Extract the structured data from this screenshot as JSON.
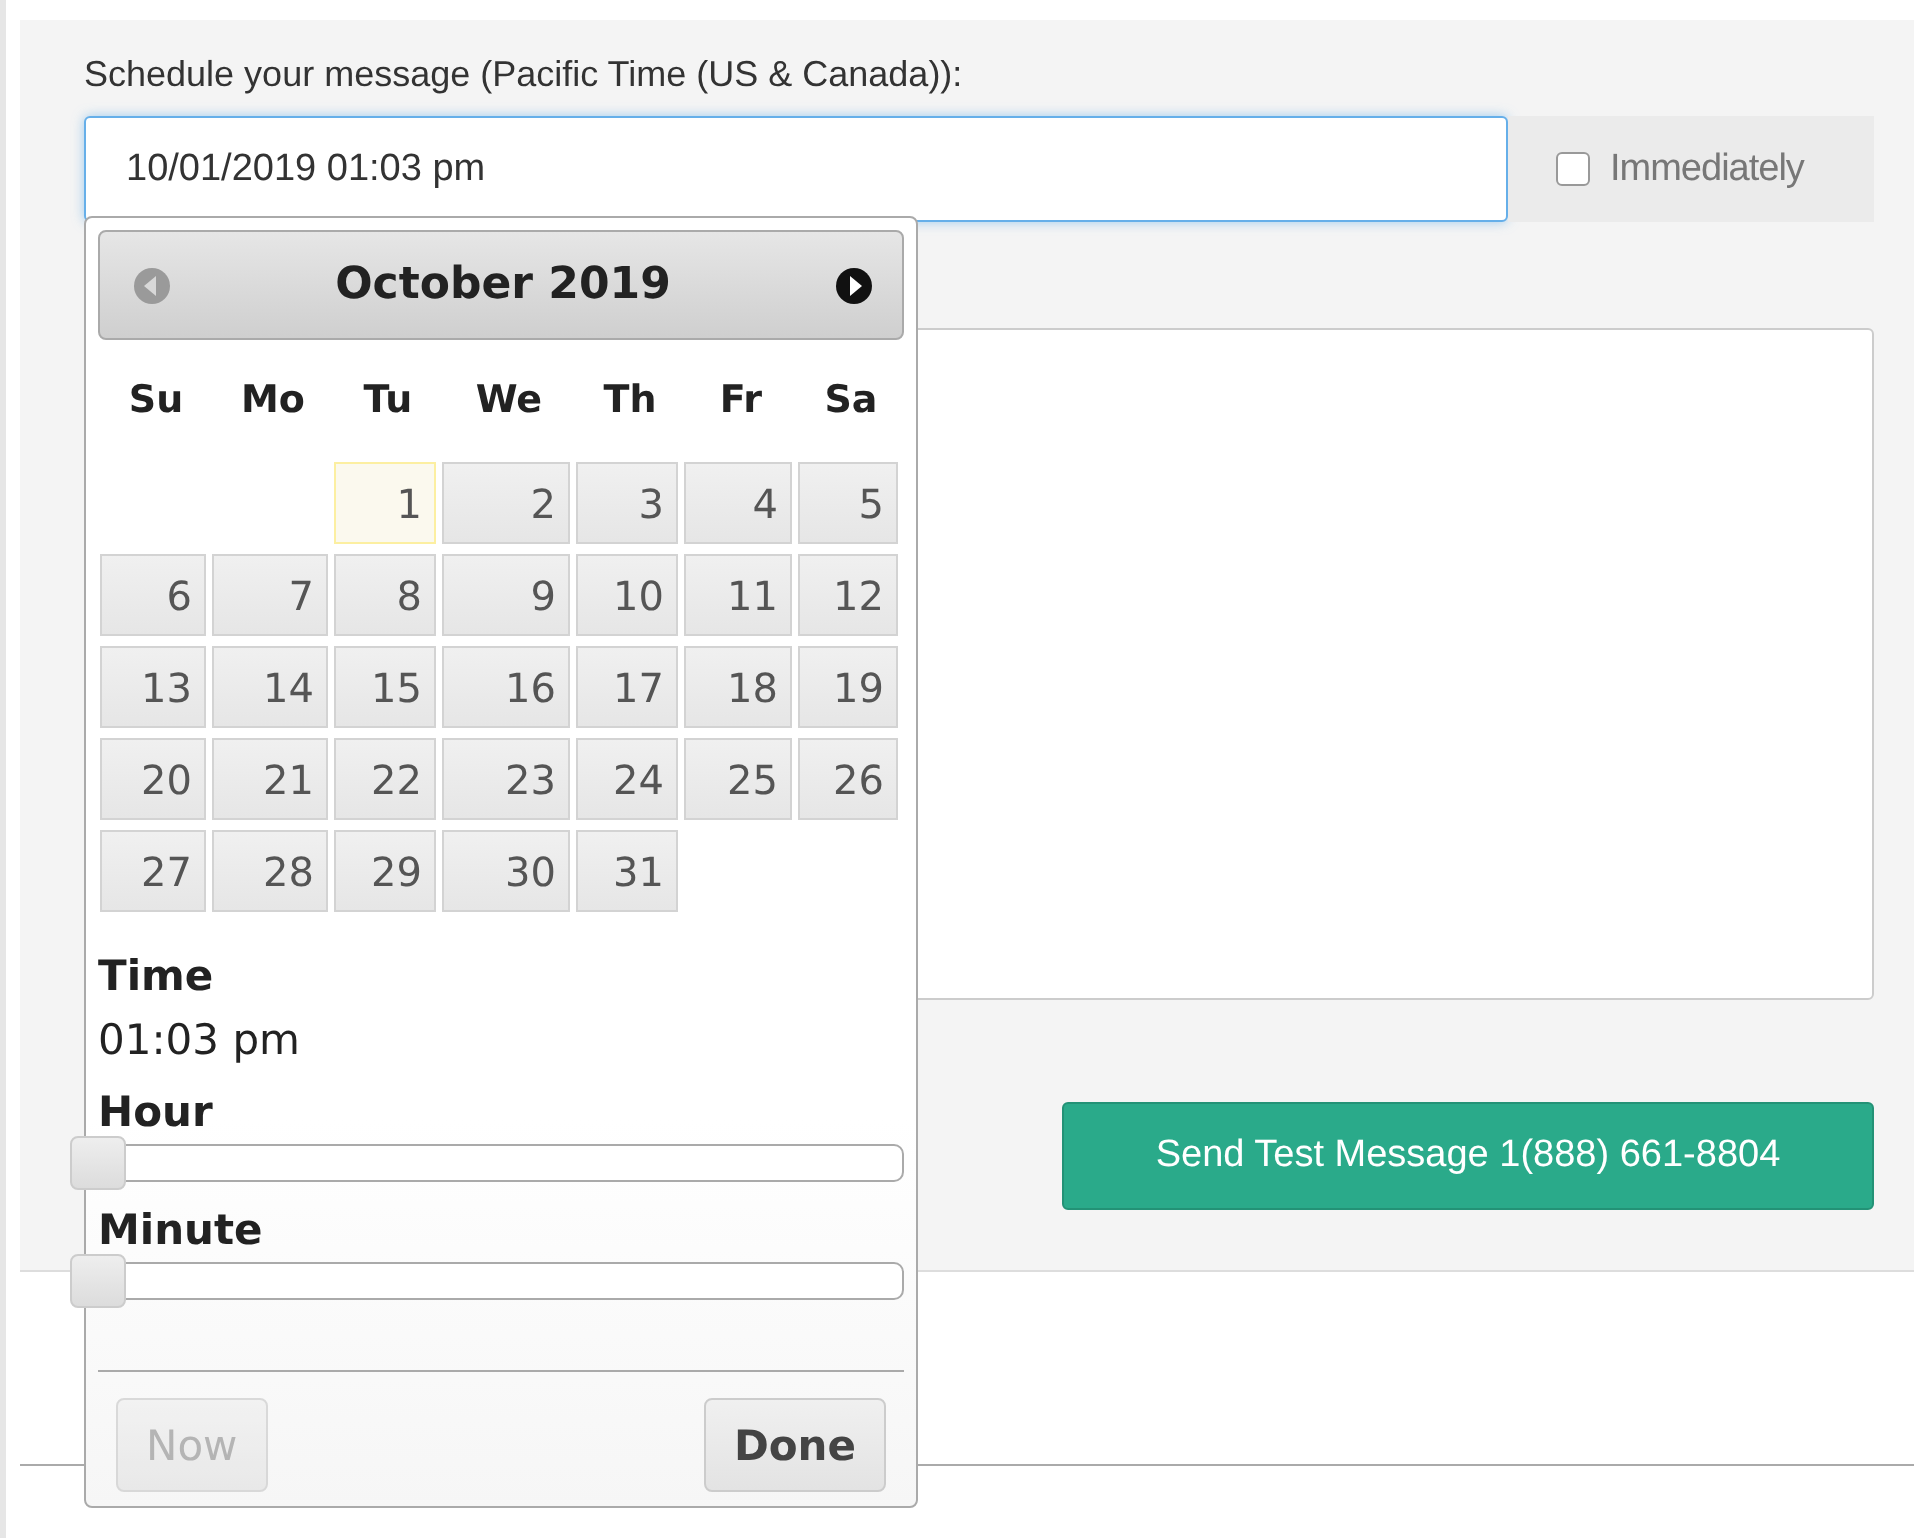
{
  "schedule": {
    "label": "Schedule your message (Pacific Time (US & Canada)):",
    "value": "10/01/2019 01:03 pm",
    "immediately": {
      "label": "Immediately",
      "checked": false
    }
  },
  "send_button": {
    "label": "Send Test Message 1(888) 661-8804"
  },
  "datepicker": {
    "title": "October 2019",
    "prev": {
      "disabled": true
    },
    "next": {
      "disabled": false
    },
    "weekdays": [
      "Su",
      "Mo",
      "Tu",
      "We",
      "Th",
      "Fr",
      "Sa"
    ],
    "weeks": [
      [
        {
          "kind": "blank"
        },
        {
          "kind": "blank"
        },
        {
          "day": "1",
          "highlighted": true
        },
        {
          "day": "2",
          "highlighted": false
        },
        {
          "day": "3",
          "highlighted": false
        },
        {
          "day": "4",
          "highlighted": false
        },
        {
          "day": "5",
          "highlighted": false
        }
      ],
      [
        {
          "day": "6",
          "highlighted": false
        },
        {
          "day": "7",
          "highlighted": false
        },
        {
          "day": "8",
          "highlighted": false
        },
        {
          "day": "9",
          "highlighted": false
        },
        {
          "day": "10",
          "highlighted": false
        },
        {
          "day": "11",
          "highlighted": false
        },
        {
          "day": "12",
          "highlighted": false
        }
      ],
      [
        {
          "day": "13",
          "highlighted": false
        },
        {
          "day": "14",
          "highlighted": false
        },
        {
          "day": "15",
          "highlighted": false
        },
        {
          "day": "16",
          "highlighted": false
        },
        {
          "day": "17",
          "highlighted": false
        },
        {
          "day": "18",
          "highlighted": false
        },
        {
          "day": "19",
          "highlighted": false
        }
      ],
      [
        {
          "day": "20",
          "highlighted": false
        },
        {
          "day": "21",
          "highlighted": false
        },
        {
          "day": "22",
          "highlighted": false
        },
        {
          "day": "23",
          "highlighted": false
        },
        {
          "day": "24",
          "highlighted": false
        },
        {
          "day": "25",
          "highlighted": false
        },
        {
          "day": "26",
          "highlighted": false
        }
      ],
      [
        {
          "day": "27",
          "highlighted": false
        },
        {
          "day": "28",
          "highlighted": false
        },
        {
          "day": "29",
          "highlighted": false
        },
        {
          "day": "30",
          "highlighted": false
        },
        {
          "day": "31",
          "highlighted": false
        },
        {
          "kind": "blank"
        },
        {
          "kind": "blank"
        }
      ]
    ],
    "time": {
      "label": "Time",
      "value": "01:03 pm"
    },
    "sliders": [
      {
        "label": "Hour",
        "level": 0
      },
      {
        "label": "Minute",
        "level": 0
      }
    ],
    "now_button": {
      "label": "Now",
      "disabled": true
    },
    "done_button": {
      "label": "Done",
      "disabled": false
    }
  }
}
